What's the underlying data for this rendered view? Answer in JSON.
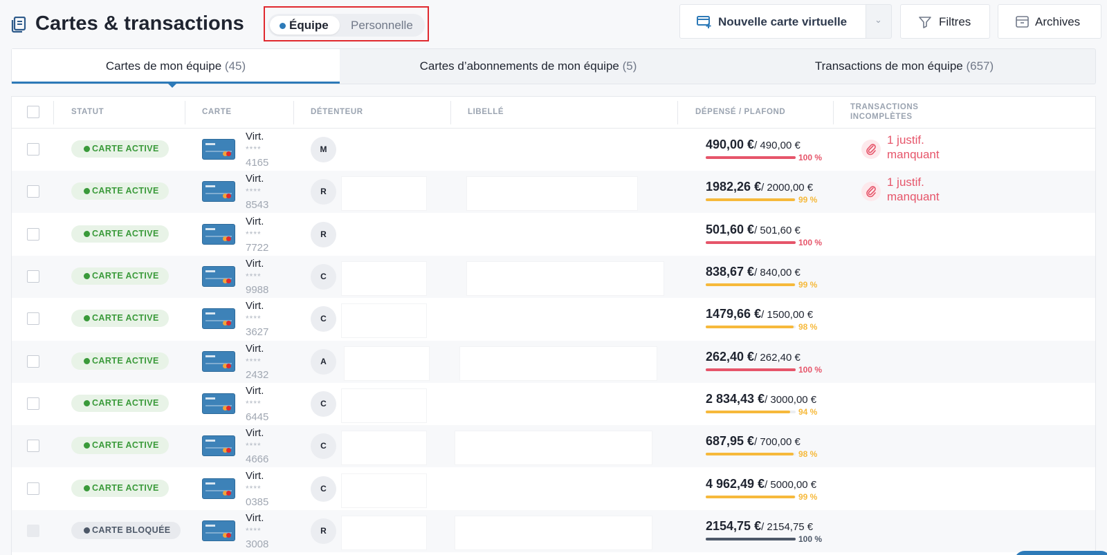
{
  "header": {
    "title": "Cartes & transactions",
    "scope": {
      "active": "Équipe",
      "inactive": "Personnelle"
    },
    "new_card_label": "Nouvelle carte virtuelle",
    "filters_label": "Filtres",
    "archives_label": "Archives"
  },
  "tabs": [
    {
      "label": "Cartes de mon équipe",
      "count": "(45)"
    },
    {
      "label": "Cartes d’abonnements de mon équipe",
      "count": "(5)"
    },
    {
      "label": "Transactions de mon équipe",
      "count": "(657)"
    }
  ],
  "columns": {
    "statut": "STATUT",
    "carte": "CARTE",
    "detenteur": "DÉTENTEUR",
    "libelle": "LIBELLÉ",
    "depense": "DÉPENSÉ / PLAFOND",
    "transactions_1": "TRANSACTIONS",
    "transactions_2": "INCOMPLÈTES"
  },
  "colors": {
    "red": "#e6556a",
    "yellow": "#f6b93b",
    "gray": "#4d5868",
    "accent": "#2d7ab8",
    "active_green": "#3a9a3a"
  },
  "rows": [
    {
      "status": "CARTE ACTIVE",
      "status_kind": "active",
      "card_type": "Virt.",
      "card_mask": "****",
      "card_last4": "4165",
      "holder_initial": "M",
      "spent": "490,00 €",
      "limit": "/ 490,00 €",
      "percent": "100 %",
      "ratio": 1.0,
      "bar_color": "red",
      "missing": "1 justif. manquant"
    },
    {
      "status": "CARTE ACTIVE",
      "status_kind": "active",
      "card_type": "Virt.",
      "card_mask": "****",
      "card_last4": "8543",
      "holder_initial": "R",
      "spent": "1982,26 €",
      "limit": "/ 2000,00 €",
      "percent": "99 %",
      "ratio": 0.99,
      "bar_color": "yellow",
      "missing": "1 justif. manquant"
    },
    {
      "status": "CARTE ACTIVE",
      "status_kind": "active",
      "card_type": "Virt.",
      "card_mask": "****",
      "card_last4": "7722",
      "holder_initial": "R",
      "spent": "501,60 €",
      "limit": "/ 501,60 €",
      "percent": "100 %",
      "ratio": 1.0,
      "bar_color": "red",
      "missing": ""
    },
    {
      "status": "CARTE ACTIVE",
      "status_kind": "active",
      "card_type": "Virt.",
      "card_mask": "****",
      "card_last4": "9988",
      "holder_initial": "C",
      "spent": "838,67 €",
      "limit": "/ 840,00 €",
      "percent": "99 %",
      "ratio": 0.99,
      "bar_color": "yellow",
      "missing": ""
    },
    {
      "status": "CARTE ACTIVE",
      "status_kind": "active",
      "card_type": "Virt.",
      "card_mask": "****",
      "card_last4": "3627",
      "holder_initial": "C",
      "spent": "1479,66 €",
      "limit": "/ 1500,00 €",
      "percent": "98 %",
      "ratio": 0.98,
      "bar_color": "yellow",
      "missing": ""
    },
    {
      "status": "CARTE ACTIVE",
      "status_kind": "active",
      "card_type": "Virt.",
      "card_mask": "****",
      "card_last4": "2432",
      "holder_initial": "A",
      "spent": "262,40 €",
      "limit": "/ 262,40 €",
      "percent": "100 %",
      "ratio": 1.0,
      "bar_color": "red",
      "missing": ""
    },
    {
      "status": "CARTE ACTIVE",
      "status_kind": "active",
      "card_type": "Virt.",
      "card_mask": "****",
      "card_last4": "6445",
      "holder_initial": "C",
      "spent": "2 834,43 €",
      "limit": "/ 3000,00 €",
      "percent": "94 %",
      "ratio": 0.94,
      "bar_color": "yellow",
      "missing": ""
    },
    {
      "status": "CARTE ACTIVE",
      "status_kind": "active",
      "card_type": "Virt.",
      "card_mask": "****",
      "card_last4": "4666",
      "holder_initial": "C",
      "spent": "687,95 €",
      "limit": "/ 700,00 €",
      "percent": "98 %",
      "ratio": 0.98,
      "bar_color": "yellow",
      "missing": ""
    },
    {
      "status": "CARTE ACTIVE",
      "status_kind": "active",
      "card_type": "Virt.",
      "card_mask": "****",
      "card_last4": "0385",
      "holder_initial": "C",
      "spent": "4 962,49 €",
      "limit": "/ 5000,00 €",
      "percent": "99 %",
      "ratio": 0.99,
      "bar_color": "yellow",
      "missing": ""
    },
    {
      "status": "CARTE BLOQUÉE",
      "status_kind": "blocked",
      "card_type": "Virt.",
      "card_mask": "****",
      "card_last4": "3008",
      "holder_initial": "R",
      "spent": "2154,75 €",
      "limit": "/ 2154,75 €",
      "percent": "100 %",
      "ratio": 1.0,
      "bar_color": "gray",
      "missing": ""
    }
  ]
}
